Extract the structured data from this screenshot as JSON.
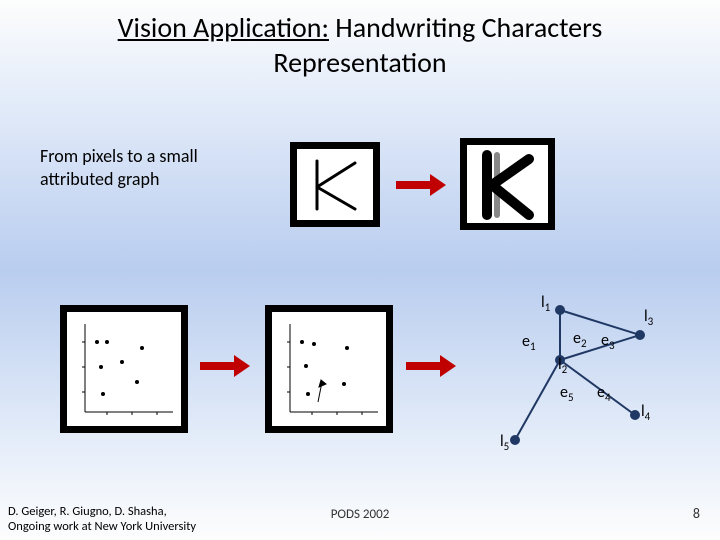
{
  "title_part1": "Vision Application:",
  "title_part2": " Handwriting Characters",
  "title_line2": "Representation",
  "subtitle": "From pixels  to a small attributed graph",
  "graph": {
    "l1": "l",
    "l1s": "1",
    "l2": "l",
    "l2s": "2",
    "l3": "l",
    "l3s": "3",
    "l4": "l",
    "l4s": "4",
    "l5": "l",
    "l5s": "5",
    "e1": "e",
    "e1s": "1",
    "e2": "e",
    "e2s": "2",
    "e3": "e",
    "e3s": "3",
    "e4": "e",
    "e4s": "4",
    "e5": "e",
    "e5s": "5"
  },
  "footer_left_line1": "D. Geiger, R. Giugno, D. Shasha,",
  "footer_left_line2": "Ongoing work at New York University",
  "footer_center": "PODS 2002",
  "footer_right": "8"
}
